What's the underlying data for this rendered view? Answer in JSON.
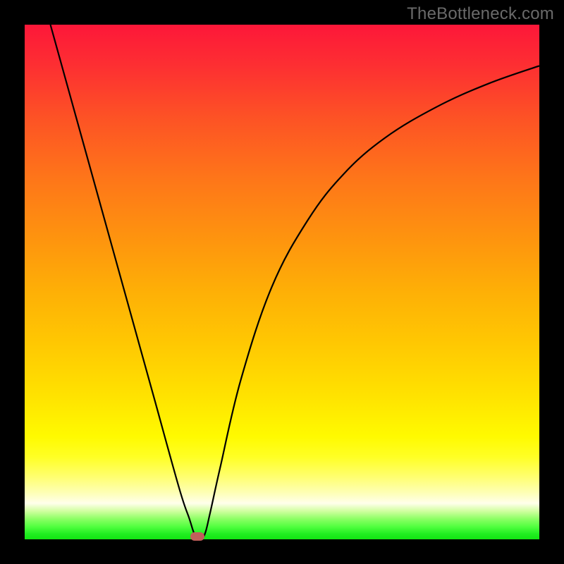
{
  "watermark": "TheBottleneck.com",
  "colors": {
    "gradient_top": "#fd1739",
    "gradient_bottom": "#13e513",
    "curve_stroke": "#000000",
    "marker_fill": "#c15f5b",
    "background": "#000000"
  },
  "chart_data": {
    "type": "line",
    "title": "",
    "xlabel": "",
    "ylabel": "",
    "xlim": [
      0,
      100
    ],
    "ylim": [
      0,
      100
    ],
    "annotations": [],
    "series": [
      {
        "name": "curve",
        "x": [
          5,
          10,
          15,
          20,
          25,
          30,
          32,
          33,
          34,
          35,
          36,
          38,
          42,
          48,
          55,
          62,
          70,
          80,
          90,
          100
        ],
        "values": [
          100,
          82,
          64,
          46,
          28,
          10,
          4,
          1,
          0,
          1,
          5,
          14,
          31,
          49,
          62,
          71,
          78,
          84,
          88.5,
          92
        ]
      }
    ],
    "marker": {
      "x": 33.5,
      "y": 0.5
    }
  }
}
